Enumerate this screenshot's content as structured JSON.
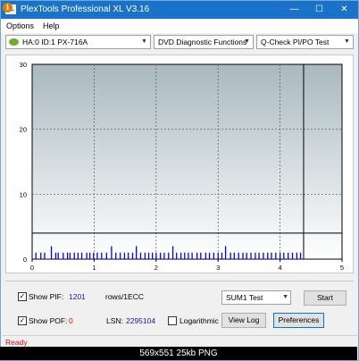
{
  "window": {
    "title": "PlexTools Professional XL V3.16",
    "icon_label": "XL",
    "minimize": "—",
    "maximize": "☐",
    "close": "✕"
  },
  "menu": {
    "options": "Options",
    "help": "Help"
  },
  "toolbar": {
    "drive": "HA:0 ID:1  PX-716A",
    "function": "DVD Diagnostic Functions",
    "test": "Q-Check PI/PO Test"
  },
  "chart_data": {
    "type": "bar",
    "xlim": [
      0,
      5
    ],
    "ylim": [
      0,
      30
    ],
    "x_ticks": [
      "0",
      "1",
      "2",
      "3",
      "4",
      "5"
    ],
    "y_ticks": [
      "0",
      "10",
      "20",
      "30"
    ],
    "threshold": 4,
    "data_end_x": 4.38,
    "grid": true,
    "series": [
      {
        "color": "#0000ff",
        "x": [
          0.06,
          0.14,
          0.2,
          0.31,
          0.38,
          0.42,
          0.5,
          0.57,
          0.61,
          0.68,
          0.74,
          0.8,
          0.88,
          0.93,
          0.99,
          1.05,
          1.12,
          1.2,
          1.28,
          1.35,
          1.42,
          1.49,
          1.55,
          1.62,
          1.68,
          1.75,
          1.82,
          1.88,
          1.94,
          2.0,
          2.07,
          2.13,
          2.2,
          2.27,
          2.33,
          2.4,
          2.46,
          2.52,
          2.58,
          2.66,
          2.72,
          2.8,
          2.86,
          2.93,
          3.0,
          3.06,
          3.12,
          3.2,
          3.26,
          3.33,
          3.4,
          3.46,
          3.53,
          3.6,
          3.66,
          3.73,
          3.8,
          3.86,
          3.93,
          4.0,
          4.06,
          4.13,
          4.2,
          4.27,
          4.33
        ],
        "y": [
          1,
          1,
          1,
          2,
          1,
          1,
          1,
          1,
          1,
          1,
          1,
          1,
          1,
          1,
          1,
          1,
          1,
          1,
          2,
          1,
          1,
          1,
          1,
          1,
          2,
          1,
          1,
          1,
          1,
          1,
          1,
          1,
          1,
          2,
          1,
          1,
          1,
          1,
          1,
          1,
          1,
          1,
          1,
          1,
          1,
          1,
          2,
          1,
          1,
          1,
          1,
          1,
          1,
          1,
          1,
          1,
          1,
          1,
          1,
          1,
          1,
          1,
          1,
          1,
          1
        ]
      }
    ]
  },
  "controls": {
    "show_pif_label": "Show PIF:",
    "pif_value": "1201",
    "pif_unit": "rows/1ECC",
    "show_pof_label": "Show POF:",
    "pof_value": "0",
    "lsn_label": "LSN:",
    "lsn_value": "2295104",
    "log_label": "Logarithmic",
    "sum_select": "SUM1 Test",
    "start": "Start",
    "view_log": "View Log",
    "preferences": "Preferences",
    "info": "i",
    "checkmark": "✓"
  },
  "status": {
    "text": "Ready"
  },
  "caption": "569x551  25kb  PNG"
}
